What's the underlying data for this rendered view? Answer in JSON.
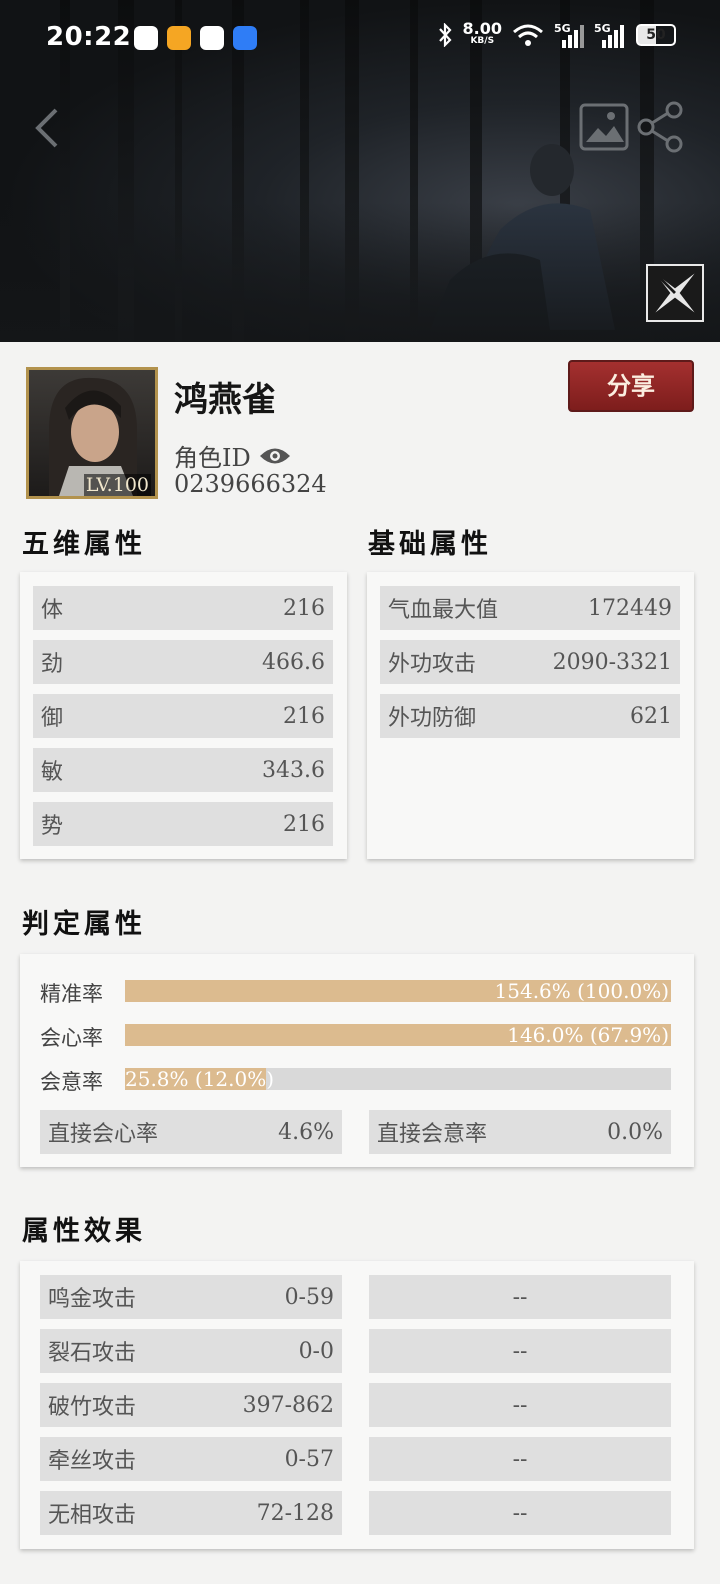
{
  "status_bar": {
    "time": "20:22",
    "net_speed": "8.00",
    "net_unit": "KB/S",
    "sig1": "5G",
    "sig2": "5G",
    "battery": "50"
  },
  "profile": {
    "name": "鸿燕雀",
    "level": "LV.100",
    "id_label": "角色ID",
    "id_value": "0239666324",
    "share_label": "分享"
  },
  "five_dim": {
    "title": "五维属性",
    "rows": [
      {
        "label": "体",
        "value": "216"
      },
      {
        "label": "劲",
        "value": "466.6"
      },
      {
        "label": "御",
        "value": "216"
      },
      {
        "label": "敏",
        "value": "343.6"
      },
      {
        "label": "势",
        "value": "216"
      }
    ]
  },
  "basic": {
    "title": "基础属性",
    "rows": [
      {
        "label": "气血最大值",
        "value": "172449"
      },
      {
        "label": "外功攻击",
        "value": "2090-3321"
      },
      {
        "label": "外功防御",
        "value": "621"
      }
    ]
  },
  "judge": {
    "title": "判定属性",
    "bars": [
      {
        "label": "精准率",
        "text": "154.6% (100.0%)",
        "fill": 1.0
      },
      {
        "label": "会心率",
        "text": "146.0% (67.9%)",
        "fill": 1.0
      },
      {
        "label": "会意率",
        "text": "25.8% (12.0%)",
        "fill": 0.258
      }
    ],
    "direct": [
      {
        "label": "直接会心率",
        "value": "4.6%"
      },
      {
        "label": "直接会意率",
        "value": "0.0%"
      }
    ]
  },
  "effects": {
    "title": "属性效果",
    "rows": [
      {
        "label": "鸣金攻击",
        "value": "0-59",
        "right": "--"
      },
      {
        "label": "裂石攻击",
        "value": "0-0",
        "right": "--"
      },
      {
        "label": "破竹攻击",
        "value": "397-862",
        "right": "--"
      },
      {
        "label": "牵丝攻击",
        "value": "0-57",
        "right": "--"
      },
      {
        "label": "无相攻击",
        "value": "72-128",
        "right": "--"
      }
    ]
  },
  "colors": {
    "bar_fill": "#dcbb8f",
    "share_button": "#8c2524"
  }
}
